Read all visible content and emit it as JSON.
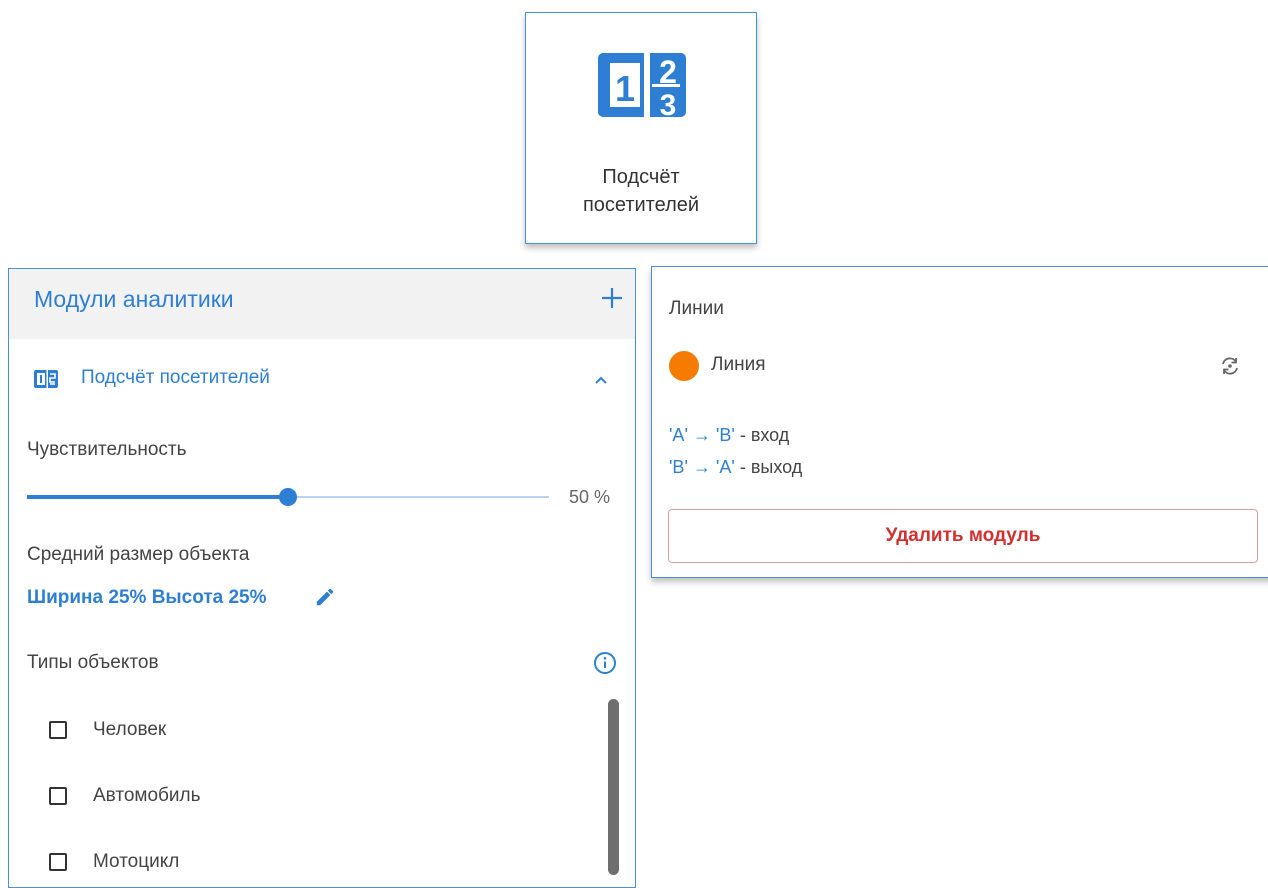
{
  "tile": {
    "label_line1": "Подсчёт",
    "label_line2": "посетителей",
    "icon": "counter-12-icon"
  },
  "analytics_panel": {
    "title": "Модули аналитики",
    "add_icon": "plus-icon",
    "module": {
      "label": "Подсчёт посетителей",
      "icon": "counter-12-icon",
      "expand_icon": "chevron-up-icon"
    },
    "sensitivity": {
      "label": "Чувствительность",
      "value": 50,
      "value_text": "50 %"
    },
    "object_size": {
      "label": "Средний размер объекта",
      "value": "Ширина 25% Высота 25%",
      "edit_icon": "pencil-icon"
    },
    "object_types": {
      "label": "Типы объектов",
      "info_icon": "info-icon",
      "items": [
        {
          "label": "Человек",
          "checked": false
        },
        {
          "label": "Автомобиль",
          "checked": false
        },
        {
          "label": "Мотоцикл",
          "checked": false
        }
      ]
    }
  },
  "lines_panel": {
    "title": "Линии",
    "line": {
      "label": "Линия",
      "color": "#f57c00",
      "swap_icon": "swap-direction-icon"
    },
    "directions": [
      {
        "from": "'A'",
        "arrow": "→",
        "to": "'B'",
        "text": "- вход"
      },
      {
        "from": "'B'",
        "arrow": "→",
        "to": "'A'",
        "text": "- выход"
      }
    ],
    "delete_label": "Удалить модуль"
  },
  "colors": {
    "accent": "#2e7fd4",
    "danger": "#d32f2f",
    "line_color": "#f57c00"
  }
}
